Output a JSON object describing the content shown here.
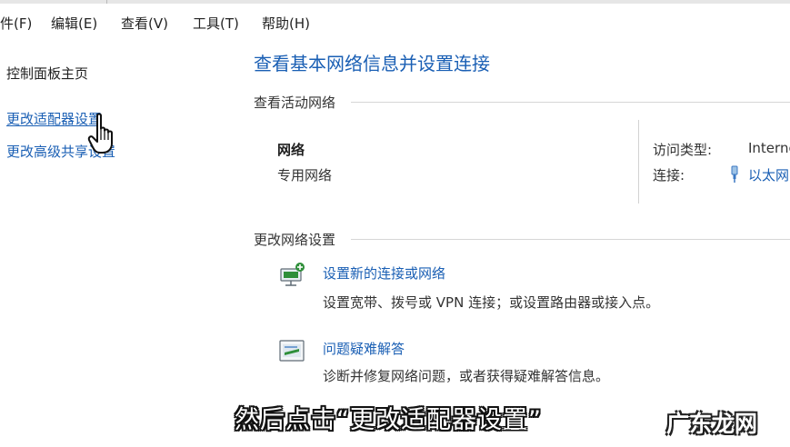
{
  "menubar": {
    "items": [
      "件(F)",
      "编辑(E)",
      "查看(V)",
      "工具(T)",
      "帮助(H)"
    ]
  },
  "sidebar": {
    "home": "控制面板主页",
    "adapter": "更改适配器设置",
    "advanced": "更改高级共享设置"
  },
  "main": {
    "title": "查看基本网络信息并设置连接",
    "active_header": "查看活动网络",
    "network": {
      "name": "网络",
      "type": "专用网络",
      "access_label": "访问类型:",
      "access_value": "Internet",
      "connection_label": "连接:",
      "connection_value": "以太网"
    },
    "change_header": "更改网络设置",
    "tasks": [
      {
        "title": "设置新的连接或网络",
        "desc": "设置宽带、拨号或 VPN 连接；或设置路由器或接入点。",
        "icon": "new-connection-icon"
      },
      {
        "title": "问题疑难解答",
        "desc": "诊断并修复网络问题，或者获得疑难解答信息。",
        "icon": "troubleshoot-icon"
      }
    ]
  },
  "overlay": {
    "subtitle": "然后点击“更改适配器设置”",
    "watermark": "广东龙网"
  },
  "colors": {
    "link": "#1a5fb4",
    "text": "#1e1e1e"
  }
}
